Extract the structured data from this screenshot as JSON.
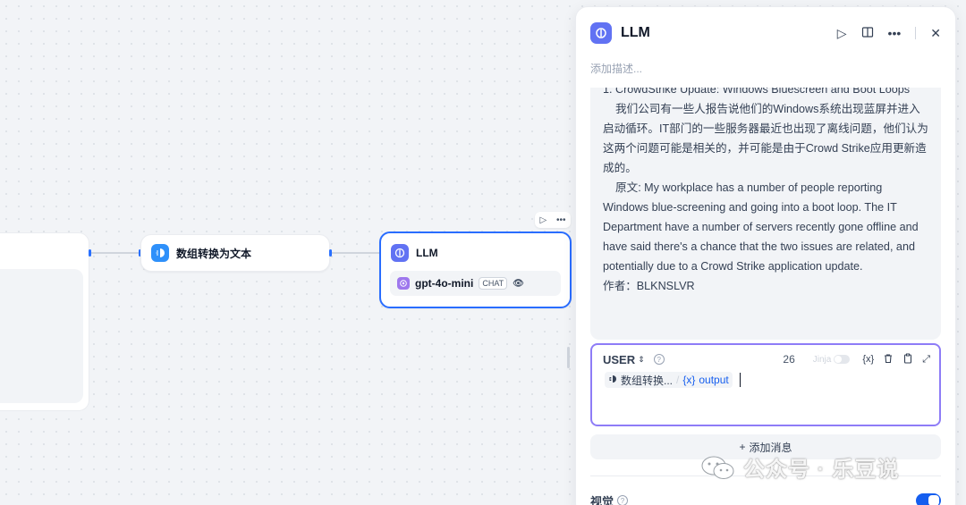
{
  "canvas": {
    "nodes": {
      "text_node": {
        "title": "数组转换为文本"
      },
      "llm_node": {
        "title": "LLM",
        "model": "gpt-4o-mini",
        "model_mode": "CHAT"
      }
    }
  },
  "panel": {
    "title": "LLM",
    "description_placeholder": "添加描述...",
    "message_text": "1. CrowdStrike Update: Windows Bluescreen and Boot Loops\n    我们公司有一些人报告说他们的Windows系统出现蓝屏并进入启动循环。IT部门的一些服务器最近也出现了离线问题，他们认为这两个问题可能是相关的，并可能是由于Crowd Strike应用更新造成的。\n    原文: My workplace has a number of people reporting Windows blue-screening and going into a boot loop. The IT Department have a number of servers recently gone offline and have said there's a chance that the two issues are related, and potentially due to a Crowd Strike application update.\n作者：BLKNSLVR",
    "user_message": {
      "role": "USER",
      "count": "26",
      "jinja_label": "Jinja",
      "variable_node": "数组转换...",
      "variable_name": "output",
      "variable_prefix": "{x}"
    },
    "add_message_label": "添加消息",
    "vision_label": "视觉"
  },
  "watermark": {
    "text": "公众号 · 乐豆说"
  },
  "colors": {
    "accent": "#155eef",
    "llm_icon": "#6172f3",
    "text_icon": "#2e90fa",
    "selected_border": "#296dff"
  }
}
